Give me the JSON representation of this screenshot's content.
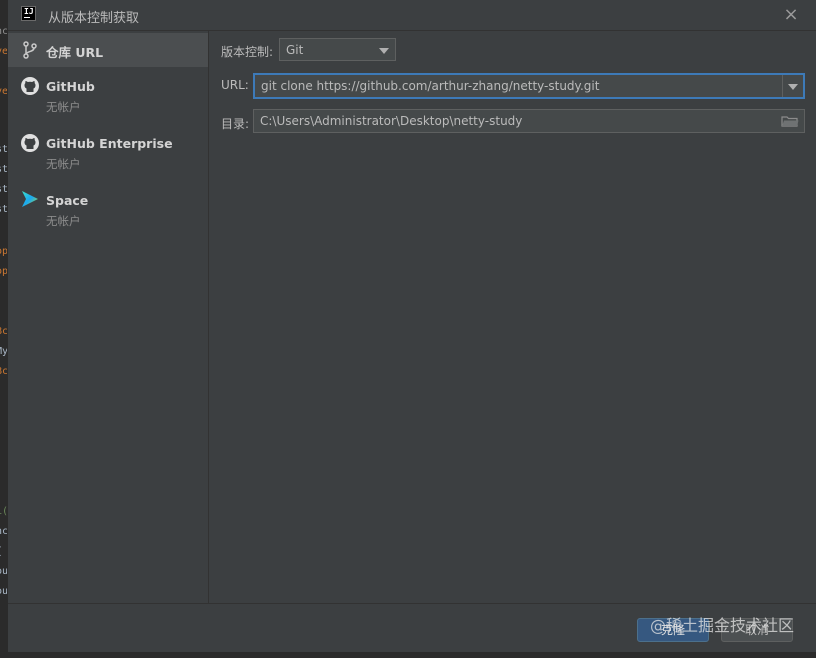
{
  "window": {
    "title": "从版本控制获取"
  },
  "editor_gutter": [
    "nc",
    "ve",
    "ve",
    "st",
    "st",
    "st",
    "st",
    "op",
    "op",
    "Bc",
    "My",
    "Bc",
    "1(",
    "nc",
    "{",
    "ou",
    "ou"
  ],
  "sidebar": {
    "items": [
      {
        "label": "仓库 URL",
        "sub": "",
        "icon": "branch-icon",
        "selected": true
      },
      {
        "label": "GitHub",
        "sub": "无帐户",
        "icon": "github-icon",
        "selected": false
      },
      {
        "label": "GitHub Enterprise",
        "sub": "无帐户",
        "icon": "github-icon",
        "selected": false
      },
      {
        "label": "Space",
        "sub": "无帐户",
        "icon": "space-icon",
        "selected": false
      }
    ]
  },
  "form": {
    "vcs_label": "版本控制:",
    "vcs_value": "Git",
    "url_label": "URL:",
    "url_value": "git clone https://github.com/arthur-zhang/netty-study.git",
    "dir_label": "目录:",
    "dir_value": "C:\\Users\\Administrator\\Desktop\\netty-study"
  },
  "footer": {
    "clone_label": "克隆",
    "cancel_label": "取消"
  },
  "watermark": "@稀土掘金技术社区",
  "colors": {
    "dialog_bg": "#3c3f41",
    "selected_bg": "#4b4e50",
    "primary_button": "#365880",
    "focus_border": "#3d7ab8"
  }
}
